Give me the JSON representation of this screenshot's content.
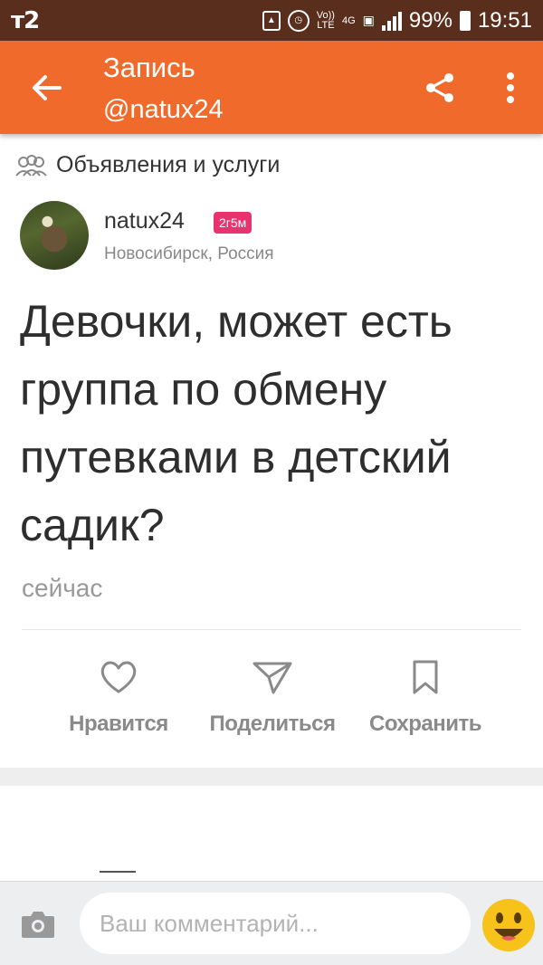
{
  "status_bar": {
    "carrier": "т2",
    "volte_top": "Vo))",
    "volte_bottom": "LTE",
    "network": "4G",
    "battery": "99%",
    "time": "19:51"
  },
  "app_bar": {
    "title": "Запись",
    "subtitle": "@natux24",
    "color": "#f06a2b"
  },
  "post": {
    "group": "Объявления и услуги",
    "author": "natux24",
    "badge": "2г5м",
    "location": "Новосибирск, Россия",
    "text": "Девочки, может есть группа по обмену путевками в детский садик?",
    "time": "сейчас",
    "actions": {
      "like": "Нравится",
      "share": "Поделиться",
      "save": "Сохранить"
    }
  },
  "comment": {
    "placeholder": "Ваш комментарий..."
  },
  "icons": [
    "back-arrow-icon",
    "share-icon",
    "more-vert-icon",
    "group-icon",
    "heart-icon",
    "send-icon",
    "bookmark-icon",
    "camera-icon",
    "emoji-icon"
  ]
}
